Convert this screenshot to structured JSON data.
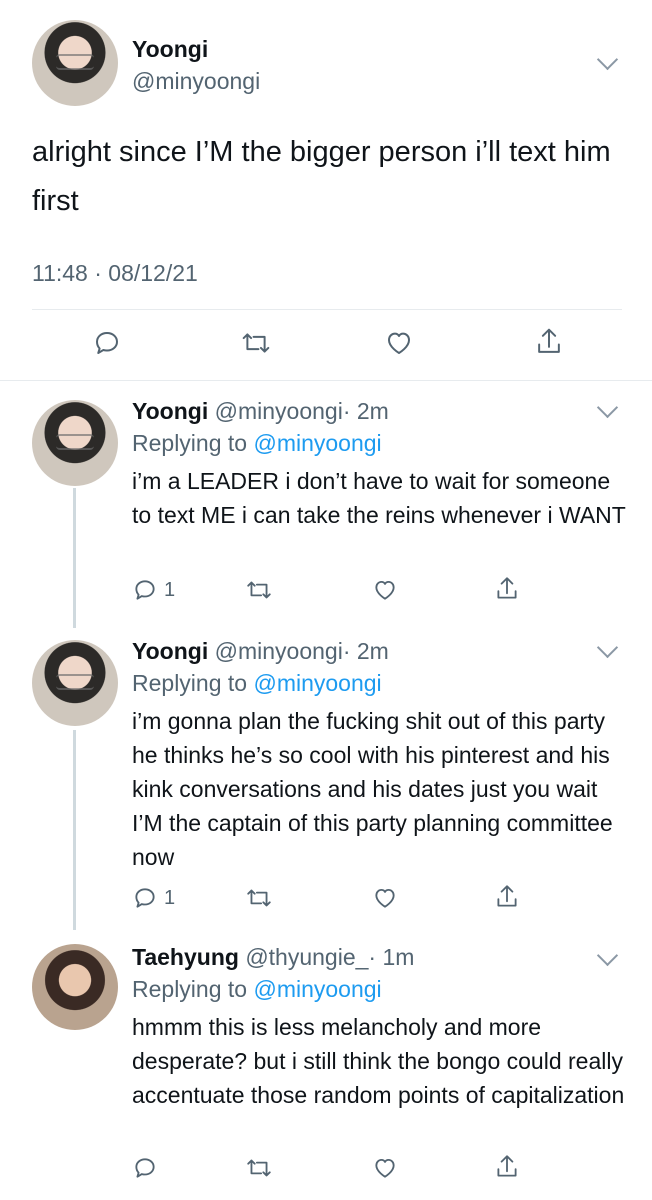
{
  "main": {
    "name": "Yoongi",
    "handle": "@minyoongi",
    "text": "alright since I’M the bigger person i’ll text him first",
    "timestamp": "11:48 · 08/12/21"
  },
  "replies": [
    {
      "name": "Yoongi",
      "handle": "@minyoongi",
      "time": "· 2m",
      "replying_prefix": "Replying to",
      "replying_to": "@minyoongi",
      "text": "i’m a LEADER i don’t have to wait for someone to text ME i can take the reins whenever i WANT",
      "reply_count": "1"
    },
    {
      "name": "Yoongi",
      "handle": "@minyoongi",
      "time": "· 2m",
      "replying_prefix": "Replying to",
      "replying_to": "@minyoongi",
      "text": "i’m gonna plan the fucking shit out of this party he thinks he’s so cool with his pinterest and his kink conversations and his dates just you wait I’M the captain of this party planning committee now",
      "reply_count": "1"
    },
    {
      "name": "Taehyung",
      "handle": "@thyungie_",
      "time": "· 1m",
      "replying_prefix": "Replying to",
      "replying_to": "@minyoongi",
      "text": "hmmm this is less melancholy and more desperate? but i still think the bongo could really accentuate those random points of capitalization",
      "reply_count": ""
    }
  ],
  "icons": {
    "reply": "reply-icon",
    "retweet": "retweet-icon",
    "like": "heart-icon",
    "share": "share-icon",
    "more": "chevron-down-icon"
  },
  "colors": {
    "text": "#0f1419",
    "secondary": "#536471",
    "link": "#1d9bf0",
    "divider": "#e7ebee"
  }
}
